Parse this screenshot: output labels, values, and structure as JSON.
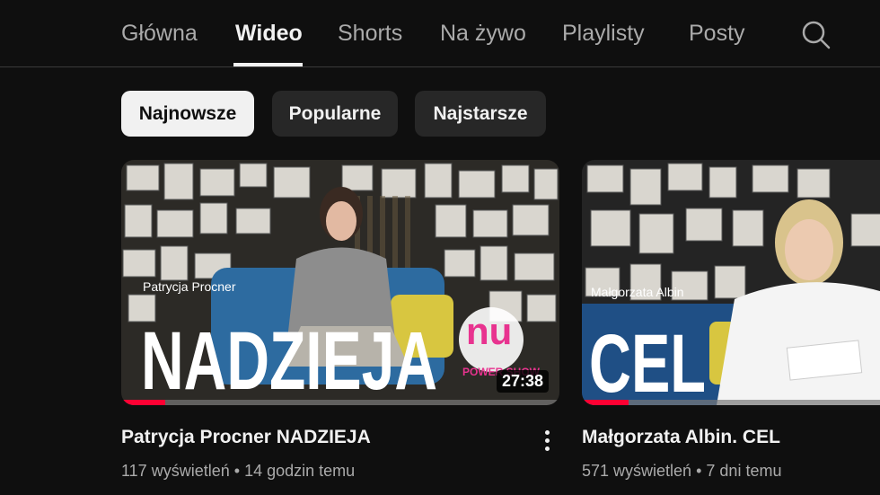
{
  "tabs": [
    {
      "label": "Główna"
    },
    {
      "label": "Wideo"
    },
    {
      "label": "Shorts"
    },
    {
      "label": "Na żywo"
    },
    {
      "label": "Playlisty"
    },
    {
      "label": "Posty"
    }
  ],
  "active_tab": "Wideo",
  "search_icon": "search-icon",
  "chips": [
    {
      "label": "Najnowsze",
      "selected": true
    },
    {
      "label": "Popularne",
      "selected": false
    },
    {
      "label": "Najstarsze",
      "selected": false
    }
  ],
  "videos": [
    {
      "title": "Patrycja Procner NADZIEJA",
      "views": "117 wyświetleń",
      "separator": "•",
      "age": "14 godzin temu",
      "duration": "27:38",
      "thumb_name_text": "Patrycja Procner",
      "thumb_big_text": "NADZIEJA",
      "thumb_logo_text": "nu",
      "thumb_logo_sub": "POWER SHOW",
      "watch_progress": 0.1
    },
    {
      "title": "Małgorzata Albin. CEL",
      "views": "571 wyświetleń",
      "separator": "•",
      "age": "7 dni temu",
      "thumb_name_text": "Małgorzata Albin",
      "thumb_big_text": "CEL",
      "watch_progress": 0.15
    }
  ],
  "colors": {
    "background": "#0f0f0f",
    "progress": "#ff0033",
    "chip_selected_bg": "#f1f1f1",
    "chip_bg": "#272727"
  }
}
